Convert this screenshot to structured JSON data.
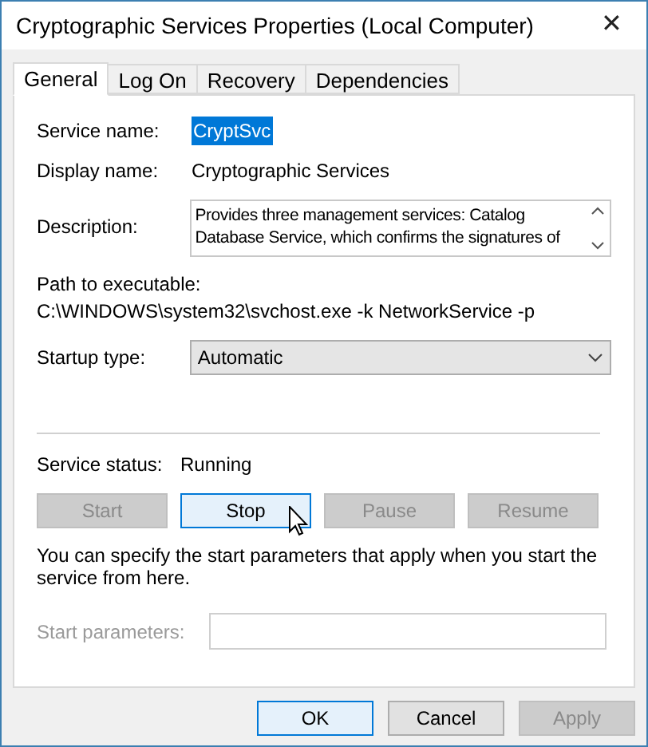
{
  "window": {
    "title": "Cryptographic Services Properties (Local Computer)",
    "close": "✕"
  },
  "tabs": [
    {
      "label": "General",
      "selected": true
    },
    {
      "label": "Log On",
      "selected": false
    },
    {
      "label": "Recovery",
      "selected": false
    },
    {
      "label": "Dependencies",
      "selected": false
    }
  ],
  "service_name": {
    "label": "Service name:",
    "value": "CryptSvc",
    "selected": true
  },
  "display_name": {
    "label": "Display name:",
    "value": "Cryptographic Services"
  },
  "description": {
    "label": "Description:",
    "value": "Provides three management services: Catalog Database Service, which confirms the signatures of"
  },
  "path": {
    "label": "Path to executable:",
    "value": "C:\\WINDOWS\\system32\\svchost.exe -k NetworkService -p"
  },
  "startup_type": {
    "label": "Startup type:",
    "value": "Automatic"
  },
  "service_status": {
    "label": "Service status:",
    "value": "Running"
  },
  "service_buttons": [
    {
      "label": "Start",
      "disabled": true,
      "focused": false
    },
    {
      "label": "Stop",
      "disabled": false,
      "focused": true
    },
    {
      "label": "Pause",
      "disabled": true,
      "focused": false
    },
    {
      "label": "Resume",
      "disabled": true,
      "focused": false
    }
  ],
  "hint": "You can specify the start parameters that apply when you start the service from here.",
  "start_parameters": {
    "label": "Start parameters:",
    "disabled": true
  },
  "dialog_buttons": [
    {
      "label": "OK",
      "disabled": false,
      "focused": true
    },
    {
      "label": "Cancel",
      "disabled": false,
      "focused": false
    },
    {
      "label": "Apply",
      "disabled": true,
      "focused": false
    }
  ]
}
